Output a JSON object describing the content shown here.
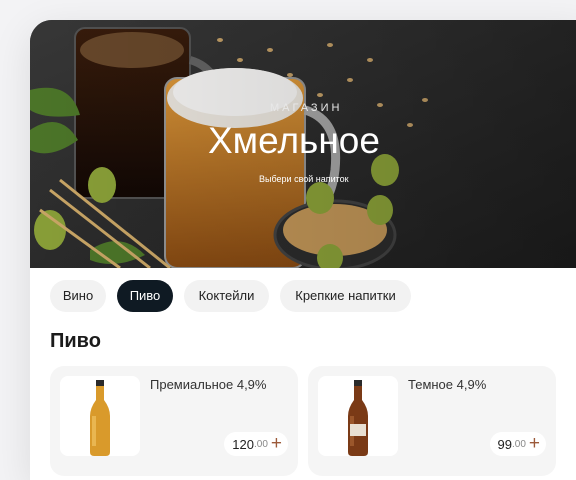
{
  "hero": {
    "eyebrow": "МАГАЗИН",
    "title": "Хмельное",
    "subtitle": "Выбери свой напиток"
  },
  "tabs": [
    {
      "label": "Вино",
      "active": false
    },
    {
      "label": "Пиво",
      "active": true
    },
    {
      "label": "Коктейли",
      "active": false
    },
    {
      "label": "Крепкие напитки",
      "active": false
    }
  ],
  "section": {
    "title": "Пиво"
  },
  "products": [
    {
      "name": "Премиальное 4,9%",
      "price": "120",
      "cents": ".00",
      "bottle_color": "#d99a2b"
    },
    {
      "name": "Темное 4,9%",
      "price": "99",
      "cents": ".00",
      "bottle_color": "#7a3a16"
    }
  ],
  "colors": {
    "accent": "#9c5a3a",
    "active_tab": "#0f1a23"
  }
}
